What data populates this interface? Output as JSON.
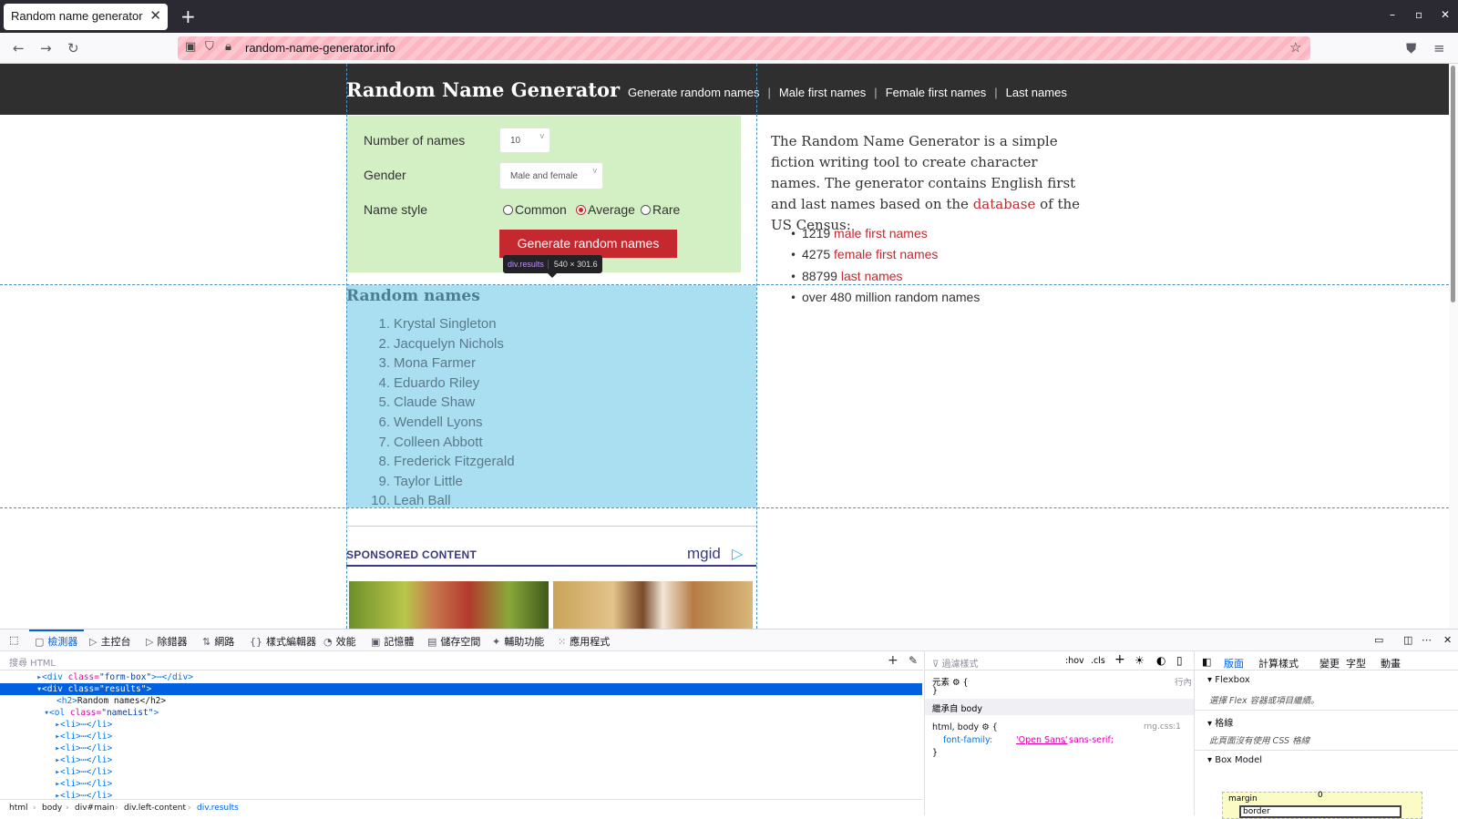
{
  "browser": {
    "tab_title": "Random name generator",
    "tab_close": "✕",
    "new_tab": "+",
    "url": "random-name-generator.info",
    "window_controls": [
      "–",
      "▫",
      "✕"
    ]
  },
  "site": {
    "title": "Random Name Generator",
    "nav": [
      "Generate random names",
      "Male first names",
      "Female first names",
      "Last names"
    ]
  },
  "form": {
    "number_label": "Number of names",
    "number_value": "10",
    "gender_label": "Gender",
    "gender_value": "Male and female",
    "style_label": "Name style",
    "styles": [
      "Common",
      "Average",
      "Rare"
    ],
    "selected_style": "Average",
    "button": "Generate random names"
  },
  "tooltip": {
    "selector": "div.results",
    "size": "540 × 301.6"
  },
  "results": {
    "heading": "Random names",
    "names": [
      "Krystal Singleton",
      "Jacquelyn Nichols",
      "Mona Farmer",
      "Eduardo Riley",
      "Claude Shaw",
      "Wendell Lyons",
      "Colleen Abbott",
      "Frederick Fitzgerald",
      "Taylor Little",
      "Leah Ball"
    ]
  },
  "sponsored": {
    "label": "SPONSORED CONTENT",
    "brand": "mgid"
  },
  "intro": {
    "text_before": "The Random Name Generator is a simple fiction writing tool to create character names. The generator contains English first and last names based on the",
    "link": "database",
    "text_after": "of the US Census:",
    "stats": [
      {
        "count": "1219",
        "label": "male first names"
      },
      {
        "count": "4275",
        "label": "female first names"
      },
      {
        "count": "88799",
        "label": "last names"
      }
    ],
    "over_prefix": "over",
    "over_text": "480 million random names"
  },
  "devtools": {
    "tabs": [
      "檢測器",
      "主控台",
      "除錯器",
      "網路",
      "樣式編輯器",
      "效能",
      "記憶體",
      "儲存空間",
      "輔助功能",
      "應用程式"
    ],
    "search_placeholder": "搜尋 HTML",
    "html_lines": [
      {
        "indent": 46,
        "tag": "<div",
        "attr": "class=",
        "val": "\"form-box\"",
        "rest": ">⋯</div>"
      },
      {
        "indent": 46,
        "tag": "<div",
        "attr": "class=",
        "val": "\"results\"",
        "rest": ">"
      },
      {
        "indent": 62,
        "tag": "<h2>",
        "attr": "",
        "val": "",
        "rest": "Random names</h2>"
      },
      {
        "indent": 54,
        "tag": "<ol",
        "attr": "class=",
        "val": "\"nameList\"",
        "rest": ">"
      },
      {
        "indent": 66,
        "tag": "<li>",
        "attr": "",
        "val": "",
        "rest": "⋯</li>"
      },
      {
        "indent": 66,
        "tag": "<li>",
        "attr": "",
        "val": "",
        "rest": "⋯</li>"
      },
      {
        "indent": 66,
        "tag": "<li>",
        "attr": "",
        "val": "",
        "rest": "⋯</li>"
      },
      {
        "indent": 66,
        "tag": "<li>",
        "attr": "",
        "val": "",
        "rest": "⋯</li>"
      },
      {
        "indent": 66,
        "tag": "<li>",
        "attr": "",
        "val": "",
        "rest": "⋯</li>"
      },
      {
        "indent": 66,
        "tag": "<li>",
        "attr": "",
        "val": "",
        "rest": "⋯</li>"
      },
      {
        "indent": 66,
        "tag": "<li>",
        "attr": "",
        "val": "",
        "rest": "⋯</li>"
      }
    ],
    "breadcrumb": [
      "html",
      "body",
      "div#main",
      "div.left-content",
      "div.results"
    ],
    "rules": {
      "filter_placeholder": "過濾樣式",
      "hov": ":hov",
      "cls": ".cls",
      "element_rule": "元素 ⚙ {",
      "element_close": "}",
      "inline": "行內",
      "inherited": "繼承自 body",
      "selector": "html, body ⚙ {",
      "source": "rng.css:1",
      "prop": "font-family:",
      "prop_val_1": "'Open Sans'",
      "prop_val_2": ", sans-serif;",
      "close": "}"
    },
    "layout": {
      "tabs": [
        "版面",
        "計算樣式",
        "變更",
        "字型",
        "動畫"
      ],
      "flexbox": "Flexbox",
      "flex_note": "選擇 Flex 容器或項目繼續。",
      "grid": "格線",
      "grid_note": "此頁面沒有使用 CSS 格線",
      "boxmodel": "Box Model",
      "margin": "margin",
      "border": "border",
      "zero": "0"
    }
  }
}
